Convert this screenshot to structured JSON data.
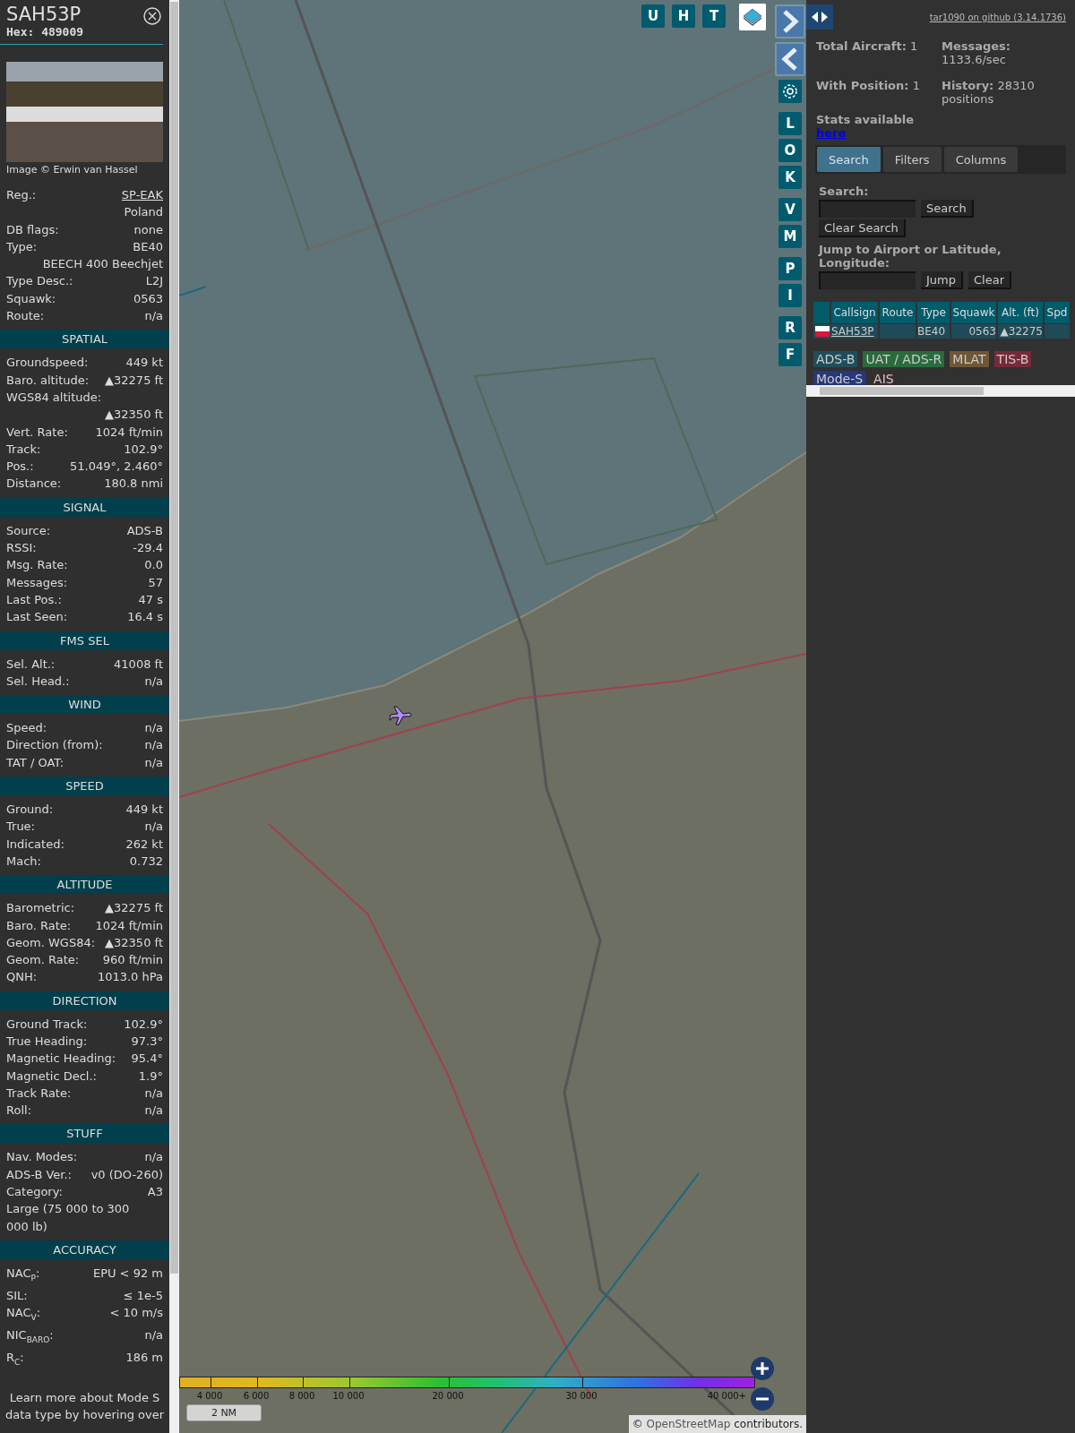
{
  "aircraft_panel": {
    "callsign": "SAH53P",
    "hex": "Hex: 489009",
    "photo_credit": "Image © Erwin van Hassel",
    "sections": [
      {
        "rows": [
          {
            "kind": "pair",
            "label": "Reg.:",
            "value": "SP-EAK",
            "link": true
          },
          {
            "kind": "value",
            "value": "Poland"
          },
          {
            "kind": "pair",
            "label": "DB flags:",
            "value": "none"
          },
          {
            "kind": "pair",
            "label": "Type:",
            "value": "BE40"
          },
          {
            "kind": "value",
            "value": "BEECH 400 Beechjet"
          },
          {
            "kind": "pair",
            "label": "Type Desc.:",
            "value": "L2J"
          },
          {
            "kind": "pair",
            "label": "Squawk:",
            "value": "0563"
          },
          {
            "kind": "pair",
            "label": "Route:",
            "value": "n/a"
          }
        ]
      },
      {
        "title": "SPATIAL",
        "rows": [
          {
            "kind": "pair",
            "label": "Groundspeed:",
            "value": "449 kt"
          },
          {
            "kind": "pair",
            "label": "Baro. altitude:",
            "value": "▲32275 ft"
          },
          {
            "kind": "label",
            "label": "WGS84 altitude:"
          },
          {
            "kind": "value",
            "value": "▲32350 ft"
          },
          {
            "kind": "pair",
            "label": "Vert. Rate:",
            "value": "1024 ft/min"
          },
          {
            "kind": "pair",
            "label": "Track:",
            "value": "102.9°"
          },
          {
            "kind": "pair",
            "label": "Pos.:",
            "value": "51.049°, 2.460°"
          },
          {
            "kind": "pair",
            "label": "Distance:",
            "value": "180.8 nmi"
          }
        ]
      },
      {
        "title": "SIGNAL",
        "rows": [
          {
            "kind": "pair",
            "label": "Source:",
            "value": "ADS-B"
          },
          {
            "kind": "pair",
            "label": "RSSI:",
            "value": "-29.4"
          },
          {
            "kind": "pair",
            "label": "Msg. Rate:",
            "value": "0.0"
          },
          {
            "kind": "pair",
            "label": "Messages:",
            "value": "57"
          },
          {
            "kind": "pair",
            "label": "Last Pos.:",
            "value": "47 s"
          },
          {
            "kind": "pair",
            "label": "Last Seen:",
            "value": "16.4 s"
          }
        ]
      },
      {
        "title": "FMS SEL",
        "rows": [
          {
            "kind": "pair",
            "label": "Sel. Alt.:",
            "value": "41008 ft"
          },
          {
            "kind": "pair",
            "label": "Sel. Head.:",
            "value": "n/a"
          }
        ]
      },
      {
        "title": "WIND",
        "rows": [
          {
            "kind": "pair",
            "label": "Speed:",
            "value": "n/a"
          },
          {
            "kind": "pair",
            "label": "Direction (from):",
            "value": "n/a"
          },
          {
            "kind": "pair",
            "label": "TAT / OAT:",
            "value": "n/a"
          }
        ]
      },
      {
        "title": "SPEED",
        "rows": [
          {
            "kind": "pair",
            "label": "Ground:",
            "value": "449 kt"
          },
          {
            "kind": "pair",
            "label": "True:",
            "value": "n/a"
          },
          {
            "kind": "pair",
            "label": "Indicated:",
            "value": "262 kt"
          },
          {
            "kind": "pair",
            "label": "Mach:",
            "value": "0.732"
          }
        ]
      },
      {
        "title": "ALTITUDE",
        "rows": [
          {
            "kind": "pair",
            "label": "Barometric:",
            "value": "▲32275 ft"
          },
          {
            "kind": "pair",
            "label": "Baro. Rate:",
            "value": "1024 ft/min"
          },
          {
            "kind": "pair",
            "label": "Geom. WGS84:",
            "value": "▲32350 ft"
          },
          {
            "kind": "pair",
            "label": "Geom. Rate:",
            "value": "960 ft/min"
          },
          {
            "kind": "pair",
            "label": "QNH:",
            "value": "1013.0 hPa"
          }
        ]
      },
      {
        "title": "DIRECTION",
        "rows": [
          {
            "kind": "pair",
            "label": "Ground Track:",
            "value": "102.9°"
          },
          {
            "kind": "pair",
            "label": "True Heading:",
            "value": "97.3°"
          },
          {
            "kind": "pair",
            "label": "Magnetic Heading:",
            "value": "95.4°"
          },
          {
            "kind": "pair",
            "label": "Magnetic Decl.:",
            "value": "1.9°"
          },
          {
            "kind": "pair",
            "label": "Track Rate:",
            "value": "n/a"
          },
          {
            "kind": "pair",
            "label": "Roll:",
            "value": "n/a"
          }
        ]
      },
      {
        "title": "STUFF",
        "rows": [
          {
            "kind": "pair",
            "label": "Nav. Modes:",
            "value": "n/a"
          },
          {
            "kind": "pair",
            "label": "ADS-B Ver.:",
            "value": "v0 (DO-260)"
          },
          {
            "kind": "pair",
            "label": "Category:",
            "value": "A3"
          },
          {
            "kind": "label",
            "label": "Large (75 000 to 300 000 lb)"
          }
        ]
      },
      {
        "title": "ACCURACY",
        "rows": [
          {
            "kind": "pair",
            "label": "NAC$_{P}$:",
            "value": "EPU < 92 m"
          },
          {
            "kind": "pair",
            "label": "SIL:",
            "value": "≤ 1e-5"
          },
          {
            "kind": "pair",
            "label": "NAC$_{V}$:",
            "value": "< 10 m/s"
          },
          {
            "kind": "pair",
            "label": "NIC$_{BARO}$:",
            "value": "n/a"
          },
          {
            "kind": "pair",
            "label": "R$_{C}$:",
            "value": "186 m"
          }
        ]
      }
    ],
    "footer": "Learn more about Mode S data type by hovering over"
  },
  "map": {
    "view_buttons": [
      "U",
      "H",
      "T"
    ],
    "side_button_groups": [
      [
        "L",
        "O",
        "K"
      ],
      [
        "V",
        "M"
      ],
      [
        "P",
        "I"
      ],
      [
        "R",
        "F"
      ]
    ],
    "altitude_legend": [
      "4 000",
      "6 000",
      "8 000",
      "10 000",
      "20 000",
      "30 000",
      "40 000+"
    ],
    "scale": "2 NM",
    "attribution": {
      "prefix": "©",
      "link": "OpenStreetMap",
      "suffix": "contributors."
    }
  },
  "right_panel": {
    "github_link": "tar1090 on github (3.14.1736)",
    "stats": [
      {
        "label": "Total Aircraft:",
        "value": "1"
      },
      {
        "label": "Messages:",
        "value": "1133.6/sec"
      },
      {
        "label": "With Position:",
        "value": "1"
      },
      {
        "label": "History:",
        "value": "28310 positions"
      }
    ],
    "stats_note": {
      "text": "Stats available",
      "link": "here"
    },
    "tabs": [
      {
        "label": "Search",
        "selected": true
      },
      {
        "label": "Filters",
        "selected": false
      },
      {
        "label": "Columns",
        "selected": false
      }
    ],
    "search": {
      "label": "Search:",
      "button": "Search",
      "clear_button": "Clear Search"
    },
    "jump": {
      "label": "Jump to Airport or Latitude, Longitude:",
      "button": "Jump",
      "clear_button": "Clear"
    },
    "table": {
      "columns": [
        "Callsign",
        "Route",
        "Type",
        "Squawk",
        "Alt. (ft)",
        "Spd"
      ],
      "rows": [
        {
          "callsign": "SAH53P",
          "type": "BE40",
          "squawk": "0563",
          "altitude": "▲32275"
        }
      ]
    },
    "source_legend": [
      {
        "label": "ADS-B",
        "color": "#1f4e5a"
      },
      {
        "label": "UAT / ADS-R",
        "color": "#2a6b3c"
      },
      {
        "label": "MLAT",
        "color": "#6e5637"
      },
      {
        "label": "TIS-B",
        "color": "#762a38"
      },
      {
        "label": "Mode-S",
        "color": "#26387a"
      },
      {
        "label": "AIS",
        "color": "#3a2c2c"
      }
    ]
  }
}
